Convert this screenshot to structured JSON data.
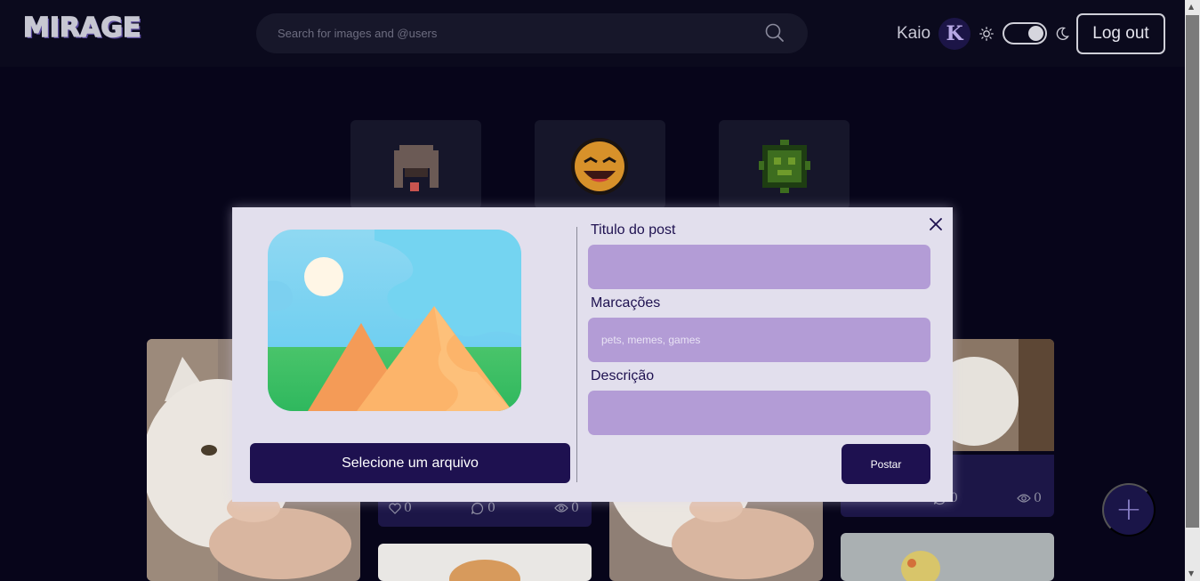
{
  "header": {
    "logo_text": "MIRAGE",
    "search_placeholder": "Search for images and @users",
    "username": "Kaio",
    "avatar_letter": "K",
    "logout_label": "Log out"
  },
  "posts": {
    "stats": [
      {
        "likes": "0",
        "comments": "0",
        "views": "0"
      },
      {
        "comments": "0",
        "views": "0"
      }
    ]
  },
  "fab": {
    "label": "+"
  },
  "modal": {
    "select_file_label": "Selecione um arquivo",
    "title_label": "Titulo do post",
    "tags_label": "Marcações",
    "tags_placeholder": "pets, memes, games",
    "description_label": "Descrição",
    "submit_label": "Postar"
  },
  "colors": {
    "background": "#07051a",
    "header": "#0b0a1d",
    "modal": "#e2dfed",
    "accent": "#1e1150",
    "field": "#b39cd6"
  }
}
